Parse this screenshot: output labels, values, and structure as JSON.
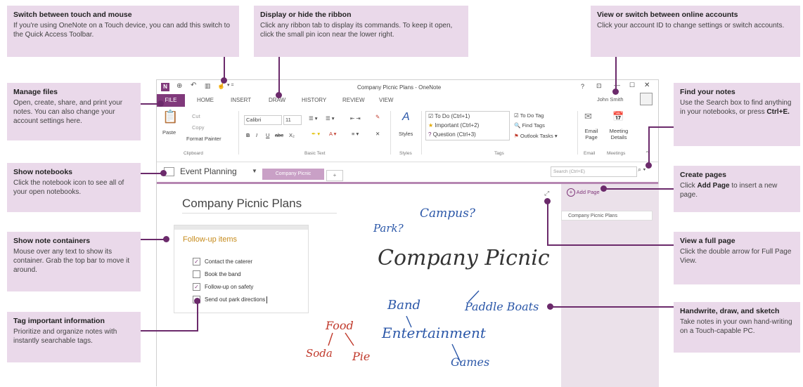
{
  "callouts": {
    "touch": {
      "title": "Switch between touch and mouse",
      "body": "If you're using OneNote on a Touch device, you can add this switch to the Quick Access Toolbar."
    },
    "ribbon": {
      "title": "Display or hide the ribbon",
      "body": "Click any ribbon tab to display its commands. To keep it open, click the small pin icon near the lower right."
    },
    "accounts": {
      "title": "View or switch between online accounts",
      "body": "Click your account ID to change settings or switch accounts."
    },
    "files": {
      "title": "Manage files",
      "body": "Open, create, share, and print your notes. You can also change your account settings here."
    },
    "find": {
      "title": "Find your notes",
      "body_pre": "Use the Search box to find anything in your notebooks, or press ",
      "body_key": "Ctrl+E."
    },
    "notebooks": {
      "title": "Show notebooks",
      "body": "Click the notebook icon to see all of your open notebooks."
    },
    "pages": {
      "title": "Create pages",
      "body_pre": "Click ",
      "body_key": "Add Page",
      "body_post": " to insert a new page."
    },
    "containers": {
      "title": "Show note containers",
      "body": "Mouse over any text to show its container. Grab the top bar to move it around."
    },
    "fullpage": {
      "title": "View a full page",
      "body": "Click the double arrow for Full Page View."
    },
    "tags": {
      "title": "Tag important information",
      "body": "Prioritize and organize notes with instantly searchable tags."
    },
    "handwrite": {
      "title": "Handwrite, draw, and sketch",
      "body": "Take notes in your own hand-writing on a Touch-capable PC."
    }
  },
  "window": {
    "title": "Company Picnic Plans - OneNote",
    "help": "?",
    "user": "John Smith"
  },
  "tabs": {
    "file": "FILE",
    "home": "HOME",
    "insert": "INSERT",
    "draw": "DRAW",
    "history": "HISTORY",
    "review": "REVIEW",
    "view": "VIEW"
  },
  "ribbon": {
    "paste": "Paste",
    "cut": "Cut",
    "copy": "Copy",
    "format_painter": "Format Painter",
    "clipboard": "Clipboard",
    "font": "Calibri",
    "size": "11",
    "bold": "B",
    "italic": "I",
    "underline": "U",
    "strike": "abc",
    "subscript": "X₂",
    "basic_text": "Basic Text",
    "styles_btn": "Styles",
    "styles": "Styles",
    "tag1": "To Do (Ctrl+1)",
    "tag2": "Important (Ctrl+2)",
    "tag3": "Question (Ctrl+3)",
    "todo_tag": "To Do Tag",
    "find_tags": "Find Tags",
    "outlook_tasks": "Outlook Tasks",
    "tags": "Tags",
    "email_page": "Email Page",
    "email": "Email",
    "meeting_details": "Meeting Details",
    "meetings": "Meetings"
  },
  "notebook": {
    "name": "Event Planning",
    "section": "Company Picnic",
    "add_section": "+",
    "search_placeholder": "Search (Ctrl+E)"
  },
  "pages": {
    "add_page": "Add Page",
    "items": [
      "Company Picnic Plans"
    ]
  },
  "page": {
    "title": "Company Picnic Plans",
    "container_title": "Follow-up items",
    "tasks": [
      {
        "text": "Contact the caterer",
        "checked": "true"
      },
      {
        "text": "Book the band",
        "checked": "false"
      },
      {
        "text": "Follow-up on safety",
        "checked": "true"
      },
      {
        "text": "Send out park directions",
        "checked": "false"
      }
    ]
  },
  "handwriting": {
    "campus": "Campus?",
    "park": "Park?",
    "picnic": "Company Picnic",
    "band": "Band",
    "paddle": "Paddle Boats",
    "entertainment": "Entertainment",
    "games": "Games",
    "food": "Food",
    "soda": "Soda",
    "pie": "Pie"
  },
  "colors": {
    "accent": "#80397b",
    "callout_bg": "#ead9ea",
    "leader": "#6b2a6b",
    "ink_blue": "#2b57a8",
    "ink_red": "#c0392b"
  }
}
